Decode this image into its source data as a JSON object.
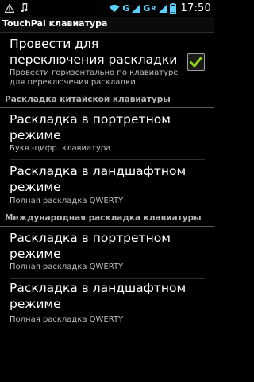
{
  "status_bar": {
    "network_1": "G",
    "network_2": "G",
    "network_3": "R",
    "time": "17:50",
    "icons": [
      "warning-icon",
      "music-note-icon",
      "wifi-icon",
      "signal-icon",
      "battery-icon"
    ]
  },
  "screen": {
    "title": "TouchPal клавиатура"
  },
  "swipe_pref": {
    "title": "Провести для переключения раскладки",
    "summary": "Провести горизонтально по клавиатуре для переключения раскладки",
    "checked": true,
    "check_color": "#8fd114"
  },
  "section_chinese": {
    "header": "Раскладка китайской клавиатуры",
    "items": [
      {
        "title": "Раскладка в портретном режиме",
        "summary": "Букв.-цифр. клавиатура"
      },
      {
        "title": "Раскладка в ландшафтном режиме",
        "summary": "Полная раскладка QWERTY"
      }
    ]
  },
  "section_international": {
    "header": "Международная раскладка клавиатуры",
    "items": [
      {
        "title": "Раскладка в портретном режиме",
        "summary": "Полная раскладка QWERTY"
      },
      {
        "title": "Раскладка в ландшафтном режиме",
        "summary": "Полная раскладка QWERTY"
      }
    ]
  }
}
